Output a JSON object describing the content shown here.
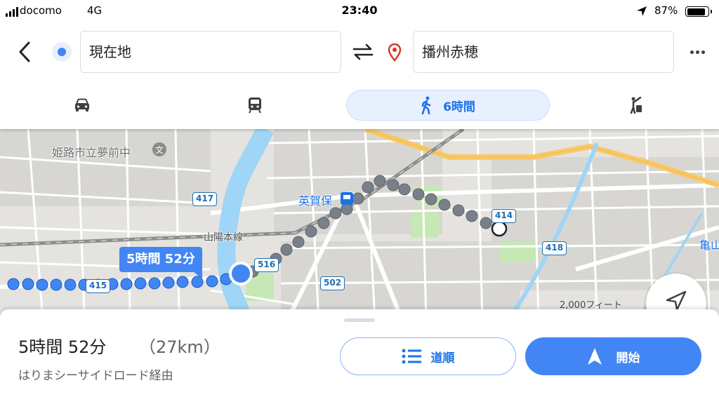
{
  "status_bar": {
    "carrier": "docomo",
    "network": "4G",
    "time": "23:40",
    "battery_percent": "87%",
    "battery_level": 0.87
  },
  "search": {
    "origin": "現在地",
    "destination": "播州赤穂"
  },
  "modes": {
    "walk_label": "6時間",
    "selected": "walk",
    "icons": [
      "car-icon",
      "train-icon",
      "walk-icon",
      "ride-icon"
    ]
  },
  "map": {
    "labels": {
      "school": "姫路市立夢前中",
      "station": "英賀保",
      "railway": "山陽本線",
      "edge_place": "亀山"
    },
    "shields": {
      "r417": "417",
      "r414": "414",
      "r418": "418",
      "r516": "516",
      "r502": "502",
      "r415": "415"
    },
    "route_callout": "5時間 52分",
    "scale": "2,000フィート",
    "colors": {
      "route_walk_past": "#7a808a",
      "route_walk_blue": "#4285f4",
      "river": "#9fd5f6",
      "park": "#c6e8b4",
      "highway": "#f8c967"
    }
  },
  "route": {
    "duration": "5時間 52分",
    "distance": "（27km）",
    "via": "はりまシーサイドロード経由",
    "steps_label": "道順",
    "start_label": "開始"
  },
  "colors": {
    "accent": "#1a73e8",
    "primary_button": "#4285f4"
  }
}
